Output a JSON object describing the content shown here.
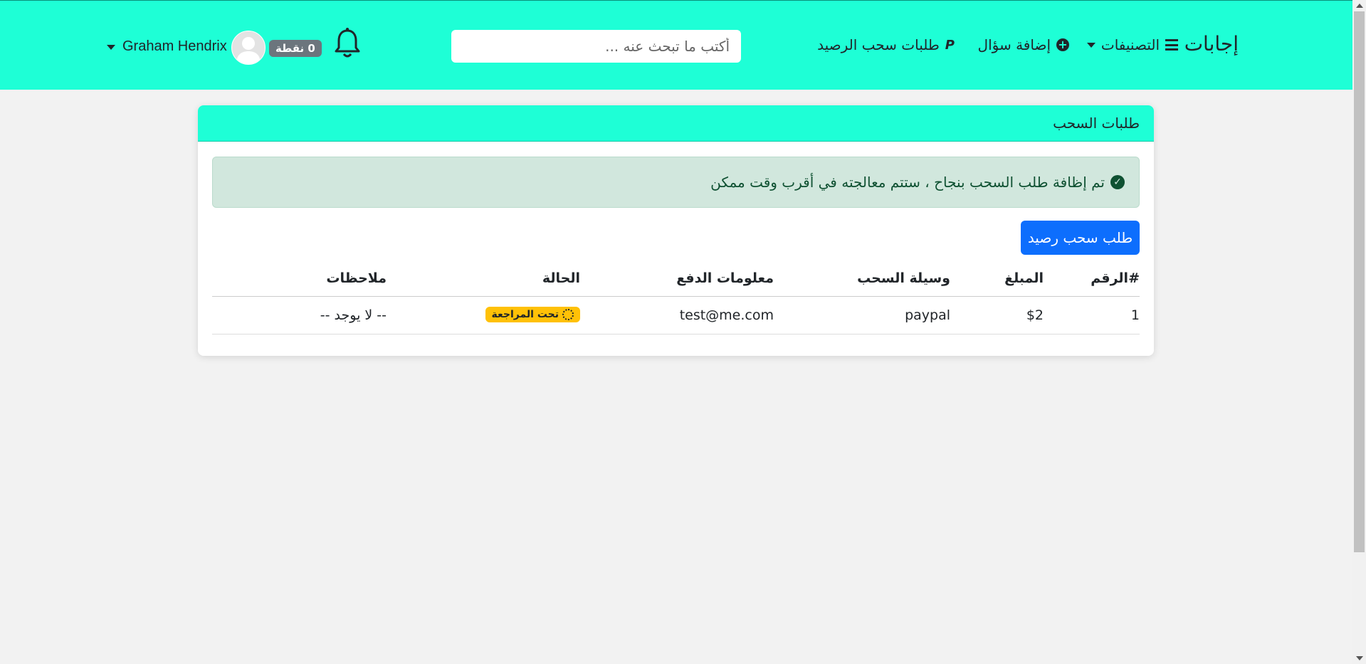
{
  "navbar": {
    "brand": "إجابات",
    "categories": "التصنيفات",
    "add_question": "إضافة سؤال",
    "withdraw_requests": "طلبات سحب الرصيد",
    "search_placeholder": "أكتب ما تبحث عنه ...",
    "points": "0 نقطة",
    "user_name": "Graham Hendrix"
  },
  "card": {
    "title": "طلبات السحب",
    "alert": "تم إظافة طلب السحب بنجاح ، ستتم معالجته في أقرب وقت ممكن",
    "withdraw_button": "طلب سحب رصيد",
    "table": {
      "headers": {
        "num": "#الرقم",
        "amount": "المبلغ",
        "method": "وسيلة السحب",
        "payment_info": "معلومات الدفع",
        "status": "الحالة",
        "notes": "ملاحظات"
      },
      "rows": [
        {
          "num": "1",
          "amount": "$2",
          "method": "paypal",
          "payment_info": "test@me.com",
          "status": "تحت المراجعة",
          "notes": "-- لا يوجد --"
        }
      ]
    }
  },
  "colors": {
    "accent": "#1effd6",
    "primary": "#0d6efd",
    "warning": "#ffc107",
    "success_bg": "#d1e7dd"
  }
}
